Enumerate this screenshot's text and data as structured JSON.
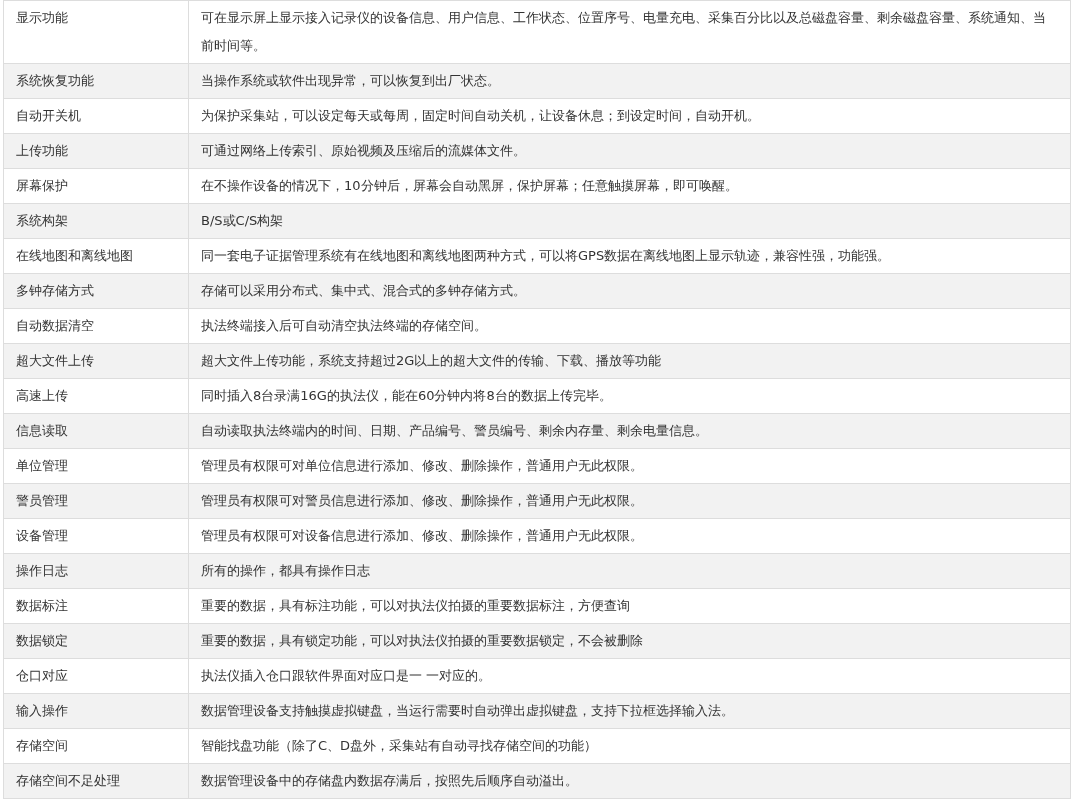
{
  "rows": [
    {
      "feature": "显示功能",
      "description": "可在显示屏上显示接入记录仪的设备信息、用户信息、工作状态、位置序号、电量充电、采集百分比以及总磁盘容量、剩余磁盘容量、系统通知、当前时间等。"
    },
    {
      "feature": "系统恢复功能",
      "description": "当操作系统或软件出现异常，可以恢复到出厂状态。"
    },
    {
      "feature": "自动开关机",
      "description": "为保护采集站，可以设定每天或每周，固定时间自动关机，让设备休息；到设定时间，自动开机。"
    },
    {
      "feature": "上传功能",
      "description": "可通过网络上传索引、原始视频及压缩后的流媒体文件。"
    },
    {
      "feature": "屏幕保护",
      "description": "在不操作设备的情况下，10分钟后，屏幕会自动黑屏，保护屏幕；任意触摸屏幕，即可唤醒。"
    },
    {
      "feature": "系统构架",
      "description": "B/S或C/S构架"
    },
    {
      "feature": "在线地图和离线地图",
      "description": "同一套电子证据管理系统有在线地图和离线地图两种方式，可以将GPS数据在离线地图上显示轨迹，兼容性强，功能强。"
    },
    {
      "feature": "多钟存储方式",
      "description": "存储可以采用分布式、集中式、混合式的多钟存储方式。"
    },
    {
      "feature": "自动数据清空",
      "description": "执法终端接入后可自动清空执法终端的存储空间。"
    },
    {
      "feature": "超大文件上传",
      "description": "超大文件上传功能，系统支持超过2G以上的超大文件的传输、下载、播放等功能"
    },
    {
      "feature": "高速上传",
      "description": "同时插入8台录满16G的执法仪，能在60分钟内将8台的数据上传完毕。"
    },
    {
      "feature": "信息读取",
      "description": "自动读取执法终端内的时间、日期、产品编号、警员编号、剩余内存量、剩余电量信息。"
    },
    {
      "feature": "单位管理",
      "description": "管理员有权限可对单位信息进行添加、修改、删除操作，普通用户无此权限。"
    },
    {
      "feature": "警员管理",
      "description": "管理员有权限可对警员信息进行添加、修改、删除操作，普通用户无此权限。"
    },
    {
      "feature": "设备管理",
      "description": "管理员有权限可对设备信息进行添加、修改、删除操作，普通用户无此权限。"
    },
    {
      "feature": "操作日志",
      "description": "所有的操作，都具有操作日志"
    },
    {
      "feature": "数据标注",
      "description": "重要的数据，具有标注功能，可以对执法仪拍摄的重要数据标注，方便查询"
    },
    {
      "feature": "数据锁定",
      "description": "重要的数据，具有锁定功能，可以对执法仪拍摄的重要数据锁定，不会被删除"
    },
    {
      "feature": "仓口对应",
      "description": "执法仪插入仓口跟软件界面对应口是一 一对应的。"
    },
    {
      "feature": "输入操作",
      "description": "数据管理设备支持触摸虚拟键盘，当运行需要时自动弹出虚拟键盘，支持下拉框选择输入法。"
    },
    {
      "feature": "存储空间",
      "description": "智能找盘功能（除了C、D盘外，采集站有自动寻找存储空间的功能）"
    },
    {
      "feature": "存储空间不足处理",
      "description": "数据管理设备中的存储盘内数据存满后，按照先后顺序自动溢出。"
    }
  ]
}
